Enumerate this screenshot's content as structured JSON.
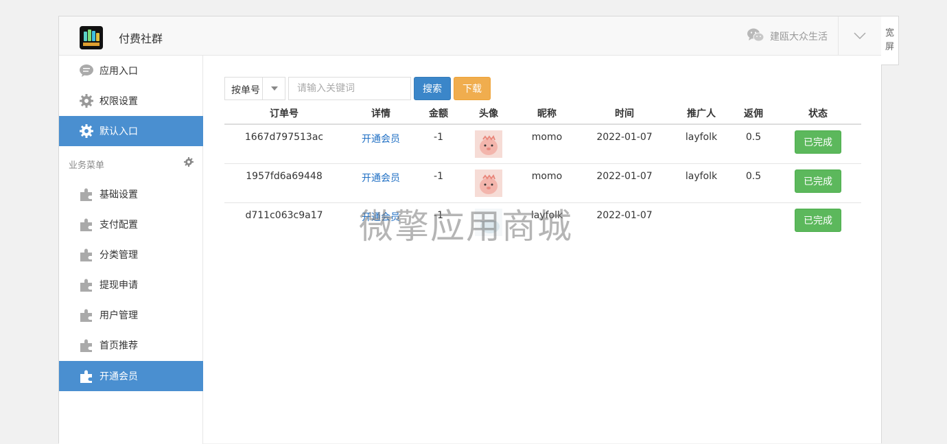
{
  "header": {
    "app_title": "付费社群",
    "account_name": "建瓯大众生活",
    "wide_label_1": "宽",
    "wide_label_2": "屏"
  },
  "sidebar": {
    "items_top": [
      {
        "label": "应用入口",
        "icon": "chat-bubble-icon"
      },
      {
        "label": "权限设置",
        "icon": "gear-icon"
      },
      {
        "label": "默认入口",
        "icon": "gear-icon",
        "active": true
      }
    ],
    "section_title": "业务菜单",
    "items_business": [
      {
        "label": "基础设置",
        "icon": "puzzle-icon"
      },
      {
        "label": "支付配置",
        "icon": "puzzle-icon"
      },
      {
        "label": "分类管理",
        "icon": "puzzle-icon"
      },
      {
        "label": "提现申请",
        "icon": "puzzle-icon"
      },
      {
        "label": "用户管理",
        "icon": "puzzle-icon"
      },
      {
        "label": "首页推荐",
        "icon": "puzzle-icon"
      },
      {
        "label": "开通会员",
        "icon": "puzzle-icon",
        "active": true
      }
    ]
  },
  "toolbar": {
    "select_value": "按单号",
    "search_placeholder": "请输入关键词",
    "search_label": "搜索",
    "download_label": "下载"
  },
  "table": {
    "headers": [
      "订单号",
      "详情",
      "金额",
      "头像",
      "昵称",
      "时间",
      "推广人",
      "返佣",
      "状态"
    ],
    "rows": [
      {
        "order": "1667d797513ac",
        "detail": "开通会员",
        "amount": "-1",
        "avatar": "pink-dino",
        "nickname": "momo",
        "time": "2022-01-07",
        "promoter": "layfolk",
        "commission": "0.5",
        "status": "已完成"
      },
      {
        "order": "1957fd6a69448",
        "detail": "开通会员",
        "amount": "-1",
        "avatar": "pink-dino",
        "nickname": "momo",
        "time": "2022-01-07",
        "promoter": "layfolk",
        "commission": "0.5",
        "status": "已完成"
      },
      {
        "order": "d711c063c9a17",
        "detail": "开通会员",
        "amount": "-1",
        "avatar": "light-blue",
        "nickname": "layfolk",
        "time": "2022-01-07",
        "promoter": "",
        "commission": "",
        "status": "已完成"
      }
    ]
  },
  "watermark": "微擎应用商城",
  "colors": {
    "sidebar_active": "#4a8fd0",
    "search_button": "#3b86c9",
    "download_button": "#f0ad4e",
    "status_button": "#5cb85c",
    "link": "#1f6fc4"
  }
}
